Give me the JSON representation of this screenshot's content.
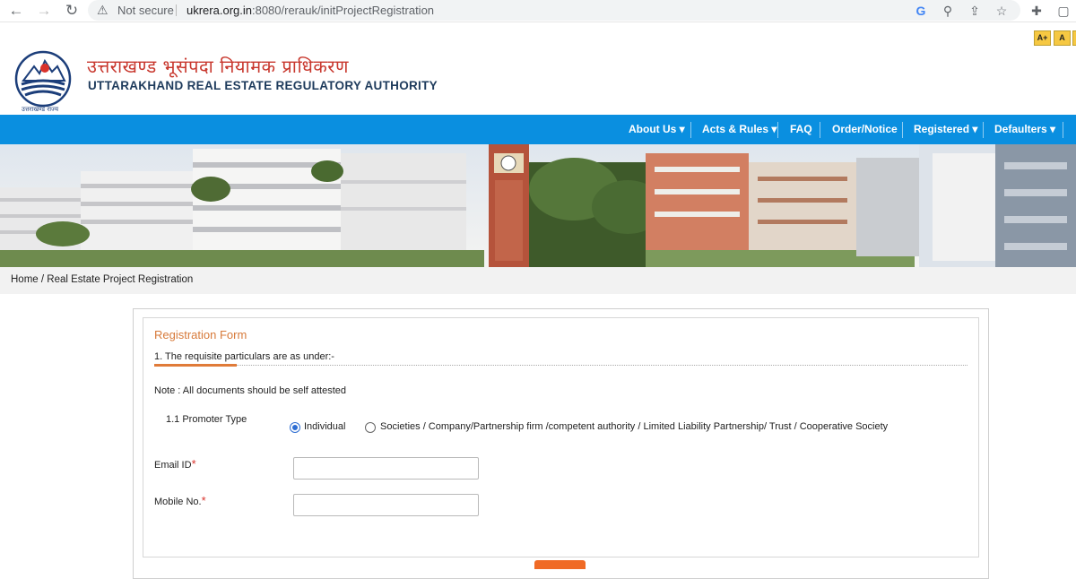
{
  "browser": {
    "back": "←",
    "forward": "→",
    "reload": "↻",
    "security_warning": "Not secure",
    "url_domain": "ukrera.org.in",
    "url_path": ":8080/rerauk/initProjectRegistration"
  },
  "accessibility": {
    "increase": "A+",
    "normal": "A"
  },
  "header": {
    "title_hindi": "उत्तराखण्ड भूसंपदा नियामक प्राधिकरण",
    "title_english": "UTTARAKHAND REAL ESTATE REGULATORY AUTHORITY",
    "logo_caption": "उत्तराखण्ड राज्य"
  },
  "nav": {
    "items": [
      {
        "label": "About Us ▾"
      },
      {
        "label": "Acts & Rules ▾"
      },
      {
        "label": "FAQ"
      },
      {
        "label": "Order/Notice"
      },
      {
        "label": "Registered ▾"
      },
      {
        "label": "Defaulters ▾"
      }
    ]
  },
  "breadcrumb": "Home / Real Estate Project Registration",
  "form": {
    "title": "Registration Form",
    "section_heading": "1. The requisite particulars are as under:-",
    "note": "Note : All documents should be self attested",
    "promoter_type_label": "1.1 Promoter Type",
    "options": [
      {
        "label": "Individual",
        "selected": true
      },
      {
        "label": "Societies / Company/Partnership firm /competent authority / Limited Liability Partnership/ Trust / Cooperative Society",
        "selected": false
      }
    ],
    "email_label": "Email ID",
    "mobile_label": "Mobile No.",
    "required_mark": "*",
    "email_value": "",
    "mobile_value": ""
  },
  "colors": {
    "nav_blue": "#0a8fe0",
    "title_red": "#c8372d",
    "accent_orange": "#e07b39",
    "button_orange": "#f06a25"
  }
}
